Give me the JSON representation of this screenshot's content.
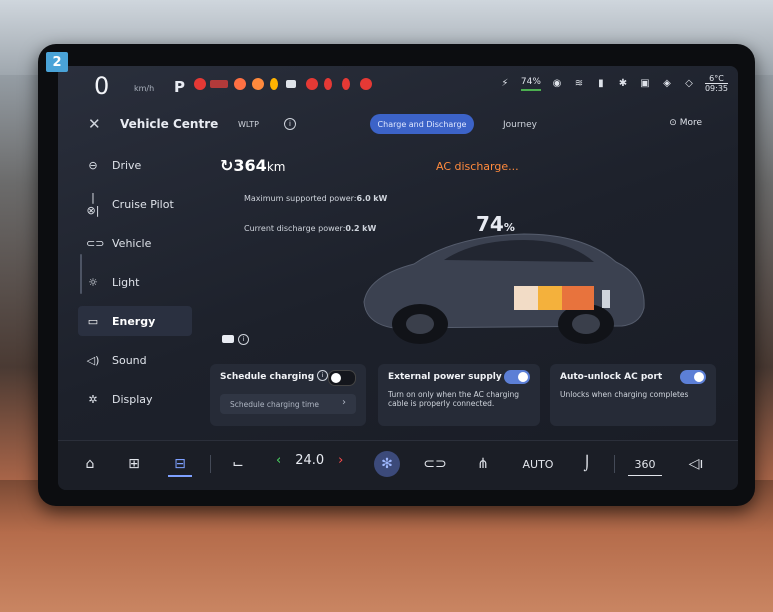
{
  "badge_number": "2",
  "status_bar": {
    "speed": "0",
    "speed_unit": "km/h",
    "gear": "P",
    "battery_percent": "74",
    "outside_temp": "6°C",
    "clock": "09:35",
    "warning_colors": [
      "#e53935",
      "#ff7043",
      "#ffb300",
      "#e53935",
      "#e53935",
      "#e53935",
      "#e53935"
    ]
  },
  "header": {
    "title": "Vehicle Centre",
    "cycle_label": "WLTP",
    "tabs": [
      {
        "label": "Charge and Discharge",
        "active": true
      },
      {
        "label": "Journey",
        "active": false
      }
    ],
    "more_label": "More"
  },
  "sidebar": {
    "items": [
      {
        "label": "Drive",
        "icon": "steering-icon"
      },
      {
        "label": "Cruise Pilot",
        "icon": "cruise-icon"
      },
      {
        "label": "Vehicle",
        "icon": "car-icon"
      },
      {
        "label": "Light",
        "icon": "light-icon"
      },
      {
        "label": "Energy",
        "icon": "battery-icon",
        "active": true
      },
      {
        "label": "Sound",
        "icon": "speaker-icon"
      },
      {
        "label": "Display",
        "icon": "brightness-icon"
      }
    ]
  },
  "energy": {
    "range_value": "364",
    "range_unit": "km",
    "status": "AC discharge...",
    "max_power_label": "Maximum supported power:",
    "max_power_value": "6.0",
    "max_power_unit": "kW",
    "current_power_label": "Current discharge power:",
    "current_power_value": "0.2",
    "current_power_unit": "kW",
    "soc_value": "74",
    "soc_unit": "%",
    "soc_fraction": 0.74
  },
  "cards": {
    "schedule": {
      "title": "Schedule charging",
      "enabled": false,
      "input_placeholder": "Schedule charging time"
    },
    "external_power": {
      "title": "External power supply",
      "enabled": true,
      "description": "Turn on only when the AC charging cable is properly connected."
    },
    "auto_unlock": {
      "title": "Auto-unlock AC port",
      "enabled": true,
      "description": "Unlocks when charging completes"
    }
  },
  "dock": {
    "temperature": "24.0",
    "auto_label": "AUTO",
    "view_label": "360"
  }
}
